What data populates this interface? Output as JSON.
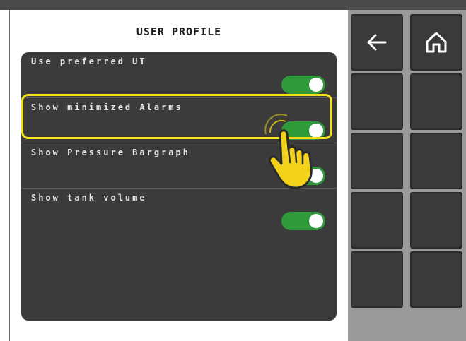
{
  "header": {
    "title": "USER PROFILE"
  },
  "settings": {
    "items": [
      {
        "label": "Use preferred UT",
        "enabled": true
      },
      {
        "label": "Show minimized Alarms",
        "enabled": true,
        "highlighted": true
      },
      {
        "label": "Show Pressure Bargraph",
        "enabled": true
      },
      {
        "label": "Show tank volume",
        "enabled": true
      }
    ]
  },
  "side_panel": {
    "buttons": [
      {
        "icon": "arrow-left-icon"
      },
      {
        "icon": "home-icon"
      },
      {
        "icon": ""
      },
      {
        "icon": ""
      },
      {
        "icon": ""
      },
      {
        "icon": ""
      },
      {
        "icon": ""
      },
      {
        "icon": ""
      },
      {
        "icon": ""
      },
      {
        "icon": ""
      }
    ]
  },
  "colors": {
    "toggle_on": "#2f9a3a",
    "highlight": "#f5e11a",
    "card_bg": "#3b3b3b",
    "side_button_bg": "#3a3a3a"
  },
  "overlay": {
    "icon": "tap-hand-icon"
  }
}
